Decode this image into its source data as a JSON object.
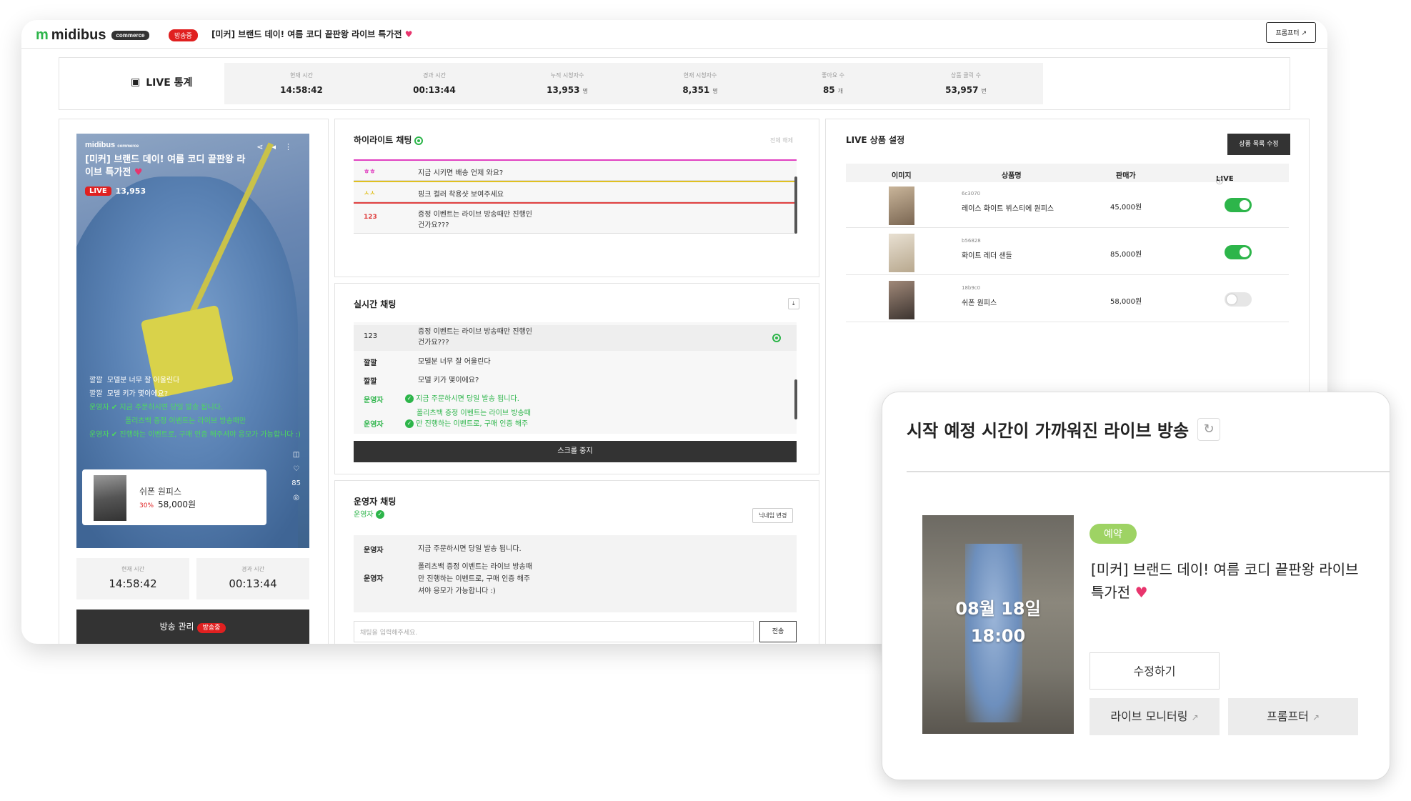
{
  "app": {
    "logo": "midibus",
    "logo_tag": "commerce",
    "onair_badge": "방송중",
    "broadcast_title": "[미커] 브랜드 데이! 여름 코디 끝판왕 라이브 특가전",
    "prompter_button": "프롬프터"
  },
  "stats": {
    "label": "LIVE 통계",
    "items": [
      {
        "label": "현재 시간",
        "value": "14:58:42",
        "unit": ""
      },
      {
        "label": "경과 시간",
        "value": "00:13:44",
        "unit": ""
      },
      {
        "label": "누적 시청자수",
        "value": "13,953",
        "unit": "명"
      },
      {
        "label": "현재 시청자수",
        "value": "8,351",
        "unit": "명"
      },
      {
        "label": "좋아요 수",
        "value": "85",
        "unit": "개"
      },
      {
        "label": "상품 클릭 수",
        "value": "53,957",
        "unit": "번"
      }
    ]
  },
  "preview": {
    "logo": "midibus",
    "logo_tag": "commerce",
    "title": "[미커] 브랜드 데이! 여름 코디 끝판왕 라이브 특가전",
    "live_badge": "LIVE",
    "viewers": "13,953",
    "chat": [
      {
        "author": "깔깔",
        "msg": "모델분 너무 잘 어울린다"
      },
      {
        "author": "깔깔",
        "msg": "모델 키가 몇이에요?"
      },
      {
        "author": "운영자",
        "msg": "지금 주문하시면 당일 발송 됩니다."
      },
      {
        "author": "",
        "msg": "폴리츠백 증정 이벤트는 라이브 방송때만"
      },
      {
        "author": "운영자",
        "msg": "진행하는 이벤트로, 구매 인증 해주셔야 응모가 가능합니다 :)"
      }
    ],
    "likes": "85",
    "product": {
      "name": "쉬폰 원피스",
      "discount": "30%",
      "price": "58,000원"
    },
    "current_time_label": "현재 시간",
    "current_time": "14:58:42",
    "elapsed_label": "경과 시간",
    "elapsed": "00:13:44",
    "manage_button": "방송 관리",
    "manage_badge": "방송중"
  },
  "highlight_chat": {
    "title": "하이라이트 채팅",
    "clear_all": "전체 해제",
    "rows": [
      {
        "author": "ㅎㅎ",
        "msg": "지금 시키면 배송 언제 와요?",
        "color": "#e040c0"
      },
      {
        "author": "ㅅㅅ",
        "msg": "핑크 컬러 착용샷 보여주세요",
        "color": "#e0c020"
      },
      {
        "author": "123",
        "msg1": "증정 이벤트는 라이브 방송때만 진행인",
        "msg2": "건가요???",
        "color": "#e04040"
      }
    ]
  },
  "realtime_chat": {
    "title": "실시간 채팅",
    "rows": [
      {
        "author": "123",
        "msg1": "증정 이벤트는 라이브 방송때만 진행인",
        "msg2": "건가요???"
      },
      {
        "author": "깔깔",
        "msg1": "모델분 너무 잘 어울린다"
      },
      {
        "author": "깔깔",
        "msg1": "모델 키가 몇이에요?"
      },
      {
        "author": "운영자",
        "msg1": "지금 주문하시면 당일 발송 됩니다."
      },
      {
        "author": "운영자",
        "msg1": "폴리츠백 증정 이벤트는 라이브 방송때",
        "msg2": "만 진행하는 이벤트로, 구매 인증 해주"
      }
    ],
    "stop_button": "스크롤 중지"
  },
  "operator_chat": {
    "title": "운영자 채팅",
    "sub": "운영자",
    "nickname_button": "닉네임 변경",
    "rows": [
      {
        "author": "운영자",
        "msg1": "지금 주문하시면 당일 발송 됩니다."
      },
      {
        "author": "운영자",
        "msg1": "폴리츠백 증정 이벤트는 라이브 방송때",
        "msg2": "만 진행하는 이벤트로, 구매 인증 해주",
        "msg3": "셔야 응모가 가능합니다 :)"
      }
    ],
    "input_placeholder": "채팅을 입력해주세요.",
    "send_button": "전송"
  },
  "products": {
    "title": "LIVE 상품 설정",
    "edit_button": "상품 목록 수정",
    "headers": [
      "이미지",
      "상품명",
      "판매가",
      "LIVE"
    ],
    "rows": [
      {
        "code": "6c3070",
        "name": "레이스 화이트 뷔스티에 원피스",
        "price": "45,000원",
        "live": true
      },
      {
        "code": "b56828",
        "name": "화이트 레더 샌들",
        "price": "85,000원",
        "live": true
      },
      {
        "code": "18b9c0",
        "name": "쉬폰 원피스",
        "price": "58,000원",
        "live": false
      }
    ]
  },
  "popup": {
    "title": "시작 예정 시간이 가까워진 라이브 방송",
    "badge": "예약",
    "date": "08월 18일",
    "time": "18:00",
    "name": "[미커] 브랜드 데이! 여름 코디 끝판왕 라이브 특가전",
    "edit_button": "수정하기",
    "monitor_button": "라이브 모니터링",
    "prompter_button": "프롬프터"
  }
}
